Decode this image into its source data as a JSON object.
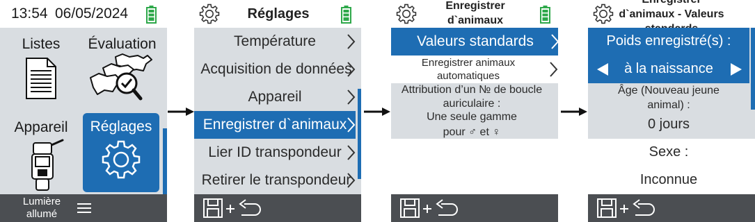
{
  "screen1": {
    "time": "13:54",
    "date": "06/05/2024",
    "tiles": [
      {
        "label": "Listes",
        "icon": "document-list-icon"
      },
      {
        "label": "Évaluation",
        "icon": "cattle-evaluation-icon"
      },
      {
        "label": "Appareil",
        "icon": "handheld-reader-icon"
      },
      {
        "label": "Réglages",
        "icon": "gear-icon"
      }
    ],
    "light_label": "Lumière\nallumé",
    "menu_icon": "hamburger-menu-icon"
  },
  "screen2": {
    "title": "Réglages",
    "items": [
      "Température",
      "Acquisition de données",
      "Appareil",
      "Enregistrer d`animaux",
      "Lier ID transpondeur",
      "Retirer le transpondeur"
    ],
    "selected_index": 3
  },
  "screen3": {
    "title": "Enregistrer\nd`animaux",
    "items": [
      "Valeurs standards",
      "Enregistrer animaux\nautomatiques",
      "Attribution d’un № de boucle\nauriculaire :",
      "Une seule gamme\npour ♂ et ♀"
    ]
  },
  "screen4": {
    "title": "Enregistrer\nd`animaux - Valeurs\nstandards",
    "weight_label": "Poids enregistré(s) :",
    "weight_value": "à la naissance",
    "age_label": "Âge (Nouveau jeune\nanimal) :",
    "age_value": "0 jours",
    "sex_label": "Sexe :",
    "sex_value": "Inconnue"
  },
  "colors": {
    "accent": "#1e6db3",
    "panel": "#d9dde1",
    "bottombar": "#4b4e52",
    "battery": "#2ea84a"
  }
}
